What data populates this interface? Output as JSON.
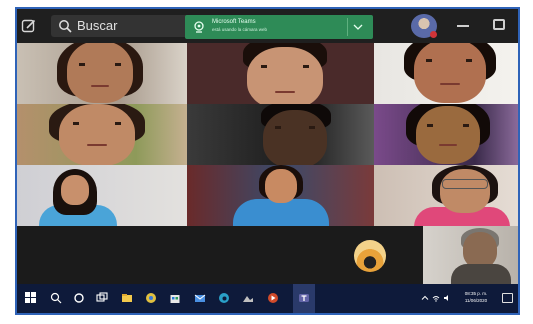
{
  "titlebar": {
    "search_label": "Buscar",
    "notification_title": "Microsoft Teams",
    "notification_subtitle": "está usando la cámara web"
  },
  "taskbar": {
    "time": "08:35 p. m.",
    "date": "11/06/2020"
  },
  "participants": [
    {
      "tile": 1
    },
    {
      "tile": 2
    },
    {
      "tile": 3
    },
    {
      "tile": 4
    },
    {
      "tile": 5
    },
    {
      "tile": 6
    },
    {
      "tile": 7
    },
    {
      "tile": 8
    },
    {
      "tile": 9
    }
  ],
  "colors": {
    "accent_border": "#2f63b8",
    "notification_bg": "#2e8b57",
    "taskbar_bg": "#0e1a3a",
    "window_bg": "#1f1f1f",
    "presence_busy": "#d13438"
  },
  "icons": [
    "compose-icon",
    "search-icon",
    "camera-icon",
    "chevron-down-icon",
    "windows-start-icon",
    "search-taskbar-icon",
    "task-view-icon",
    "file-explorer-icon",
    "chrome-icon",
    "teams-icon",
    "notification-center-icon"
  ]
}
